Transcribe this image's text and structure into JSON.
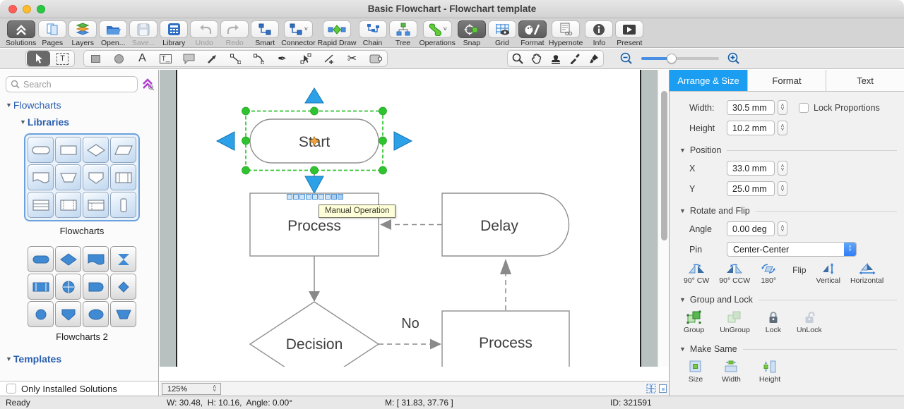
{
  "window": {
    "title": "Basic Flowchart - Flowchart template"
  },
  "toolbar": {
    "items": [
      {
        "label": "Solutions",
        "state": "active"
      },
      {
        "label": "Pages",
        "state": "normal"
      },
      {
        "label": "Layers",
        "state": "normal"
      },
      {
        "label": "Open...",
        "state": "normal"
      },
      {
        "label": "Save...",
        "state": "disabled"
      },
      {
        "label": "Library",
        "state": "normal"
      },
      {
        "label": "Undo",
        "state": "disabled"
      },
      {
        "label": "Redo",
        "state": "disabled"
      },
      {
        "label": "Smart",
        "state": "normal"
      },
      {
        "label": "Connector",
        "state": "normal",
        "chevron": "˅"
      },
      {
        "label": "Rapid Draw",
        "state": "normal"
      },
      {
        "label": "Chain",
        "state": "normal"
      },
      {
        "label": "Tree",
        "state": "normal"
      },
      {
        "label": "Operations",
        "state": "normal",
        "chevron": "˅"
      },
      {
        "label": "Snap",
        "state": "active"
      },
      {
        "label": "Grid",
        "state": "normal"
      },
      {
        "label": "Format",
        "state": "active"
      },
      {
        "label": "Hypernote",
        "state": "normal"
      },
      {
        "label": "Info",
        "state": "normal"
      },
      {
        "label": "Present",
        "state": "normal"
      }
    ]
  },
  "sidebar": {
    "search_placeholder": "Search",
    "sections": {
      "flowcharts": "Flowcharts",
      "libraries": "Libraries",
      "templates": "Templates"
    },
    "palettes": [
      {
        "name": "Flowcharts"
      },
      {
        "name": "Flowcharts 2"
      }
    ],
    "only_installed_label": "Only Installed Solutions"
  },
  "canvas": {
    "zoom_level": "125%",
    "tooltip": "Manual Operation",
    "edge_label": "No",
    "shapes": {
      "start": "Start",
      "process1": "Process",
      "delay": "Delay",
      "decision": "Decision",
      "process2": "Process"
    }
  },
  "panel": {
    "tabs": [
      {
        "label": "Arrange & Size"
      },
      {
        "label": "Format"
      },
      {
        "label": "Text"
      }
    ],
    "size": {
      "width_label": "Width:",
      "width_value": "30.5 mm",
      "height_label": "Height",
      "height_value": "10.2 mm",
      "lock_label": "Lock Proportions"
    },
    "position": {
      "header": "Position",
      "x_label": "X",
      "x_value": "33.0 mm",
      "y_label": "Y",
      "y_value": "25.0 mm"
    },
    "rotate": {
      "header": "Rotate and Flip",
      "angle_label": "Angle",
      "angle_value": "0.00 deg",
      "pin_label": "Pin",
      "pin_value": "Center-Center",
      "buttons": [
        "90° CW",
        "90° CCW",
        "180°"
      ],
      "flip_label": "Flip",
      "flip_buttons": [
        "Vertical",
        "Horizontal"
      ]
    },
    "group": {
      "header": "Group and Lock",
      "buttons": [
        "Group",
        "UnGroup",
        "Lock",
        "UnLock"
      ]
    },
    "make_same": {
      "header": "Make Same",
      "buttons": [
        "Size",
        "Width",
        "Height"
      ]
    }
  },
  "statusbar": {
    "ready": "Ready",
    "dims": "W: 30.48,  H: 10.16,  Angle: 0.00°",
    "mouse": "M: [ 31.83, 37.76 ]",
    "id": "ID: 321591"
  },
  "colors": {
    "accent_blue": "#1b9ef2",
    "selection_green": "#2fc32f",
    "arrow_blue": "#2da1e8",
    "heading_blue": "#2a5fae",
    "shape_blue": "#3f8ad2"
  }
}
